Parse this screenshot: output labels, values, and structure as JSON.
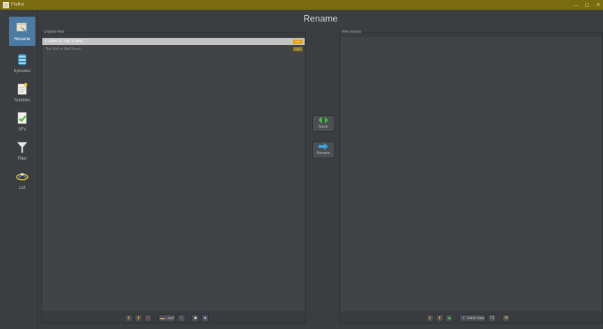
{
  "window": {
    "title": "FileBot",
    "controls": [
      "—",
      "▢",
      "✕"
    ]
  },
  "sidebar": {
    "items": [
      {
        "label": "Rename",
        "icon": "rename-icon",
        "active": true
      },
      {
        "label": "Episodes",
        "icon": "episodes-icon"
      },
      {
        "label": "Subtitles",
        "icon": "subtitles-icon"
      },
      {
        "label": "SFV",
        "icon": "sfv-icon"
      },
      {
        "label": "Filter",
        "icon": "filter-icon"
      },
      {
        "label": "List",
        "icon": "list-icon"
      }
    ]
  },
  "header": {
    "title": "Rename"
  },
  "original_files": {
    "caption": "Original Files",
    "rows": [
      {
        "name": "CLASH OF THE TITANS",
        "tag": "mkv",
        "selected": true
      },
      {
        "name": "The Wolf of Wall Street",
        "tag": "mkv",
        "selected": false
      }
    ]
  },
  "new_names": {
    "caption": "New Names"
  },
  "actions": {
    "match": {
      "label": "Match",
      "icon": "match-arrows-icon"
    },
    "rename": {
      "label": "Rename",
      "icon": "rename-arrow-icon"
    }
  },
  "left_toolbar": {
    "load_label": "Load",
    "icons": [
      "move-down-icon",
      "move-up-icon",
      "remove-icon",
      "folder-icon",
      "refresh-icon",
      "save-icon",
      "clear-icon"
    ]
  },
  "right_toolbar": {
    "fetch_label": "Fetch Data",
    "icons": [
      "move-down-icon",
      "move-up-icon",
      "match-icon",
      "fetch-icon",
      "copy-icon",
      "settings-icon"
    ]
  },
  "colors": {
    "titlebar": "#7b6b10",
    "accent": "#4d7aa2",
    "selection": "#c4c4c4",
    "tag": "#e8a100",
    "match_green": "#3fbf3f",
    "rename_blue": "#3aa0e0"
  }
}
